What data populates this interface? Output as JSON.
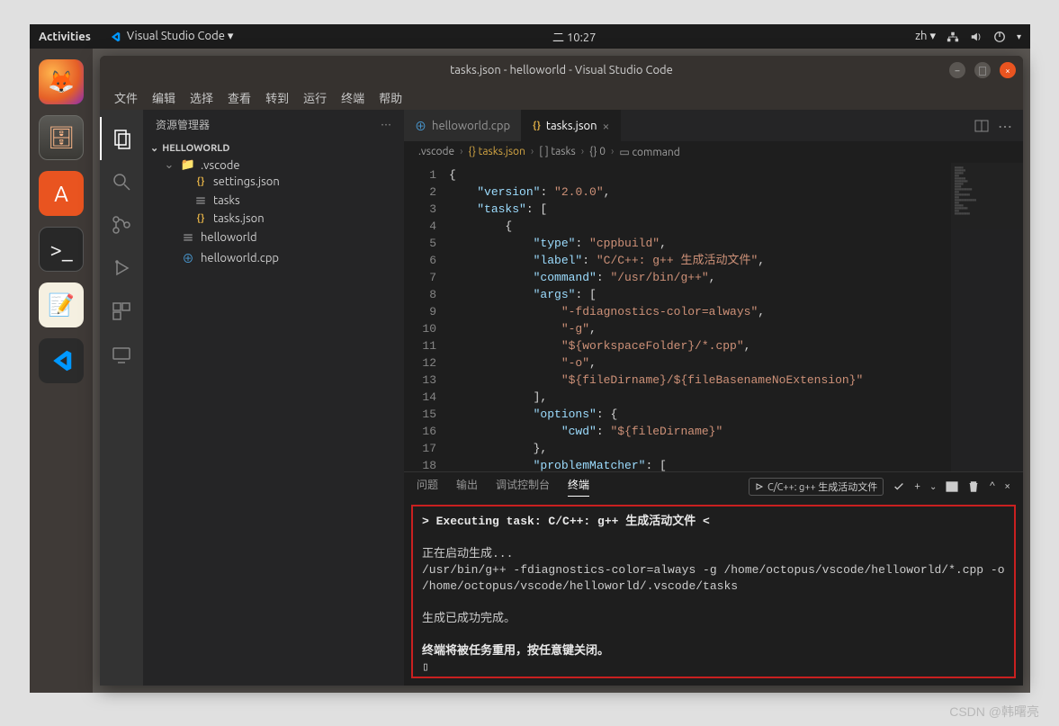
{
  "topPanel": {
    "activities": "Activities",
    "appName": "Visual Studio Code ▾",
    "clock": "二 10:27",
    "lang": "zh ▾"
  },
  "window": {
    "title": "tasks.json - helloworld - Visual Studio Code"
  },
  "menu": [
    "文件",
    "编辑",
    "选择",
    "查看",
    "转到",
    "运行",
    "终端",
    "帮助"
  ],
  "sidebar": {
    "title": "资源管理器",
    "root": "HELLOWORLD",
    "items": [
      {
        "name": ".vscode",
        "type": "folder",
        "open": true,
        "indent": 1
      },
      {
        "name": "settings.json",
        "type": "json",
        "indent": 2
      },
      {
        "name": "tasks",
        "type": "file",
        "indent": 2
      },
      {
        "name": "tasks.json",
        "type": "json",
        "indent": 2
      },
      {
        "name": "helloworld",
        "type": "file",
        "indent": 1
      },
      {
        "name": "helloworld.cpp",
        "type": "cpp",
        "indent": 1
      }
    ]
  },
  "tabs": [
    {
      "label": "helloworld.cpp",
      "icon": "cpp",
      "active": false
    },
    {
      "label": "tasks.json",
      "icon": "json",
      "active": true
    }
  ],
  "breadcrumb": [
    ".vscode",
    "{} tasks.json",
    "[ ] tasks",
    "{} 0",
    "▭ command"
  ],
  "code": {
    "lines": [
      [
        {
          "cls": "tok-brace",
          "t": "{"
        }
      ],
      [
        {
          "cls": "",
          "t": "    "
        },
        {
          "cls": "tok-key",
          "t": "\"version\""
        },
        {
          "cls": "tok-punct",
          "t": ": "
        },
        {
          "cls": "tok-str",
          "t": "\"2.0.0\""
        },
        {
          "cls": "tok-punct",
          "t": ","
        }
      ],
      [
        {
          "cls": "",
          "t": "    "
        },
        {
          "cls": "tok-key",
          "t": "\"tasks\""
        },
        {
          "cls": "tok-punct",
          "t": ": ["
        }
      ],
      [
        {
          "cls": "",
          "t": "        "
        },
        {
          "cls": "tok-brace",
          "t": "{"
        }
      ],
      [
        {
          "cls": "",
          "t": "            "
        },
        {
          "cls": "tok-key",
          "t": "\"type\""
        },
        {
          "cls": "tok-punct",
          "t": ": "
        },
        {
          "cls": "tok-str",
          "t": "\"cppbuild\""
        },
        {
          "cls": "tok-punct",
          "t": ","
        }
      ],
      [
        {
          "cls": "",
          "t": "            "
        },
        {
          "cls": "tok-key",
          "t": "\"label\""
        },
        {
          "cls": "tok-punct",
          "t": ": "
        },
        {
          "cls": "tok-str",
          "t": "\"C/C++: g++ 生成活动文件\""
        },
        {
          "cls": "tok-punct",
          "t": ","
        }
      ],
      [
        {
          "cls": "",
          "t": "            "
        },
        {
          "cls": "tok-key",
          "t": "\"command\""
        },
        {
          "cls": "tok-punct",
          "t": ": "
        },
        {
          "cls": "tok-str",
          "t": "\"/usr/bin/g++\""
        },
        {
          "cls": "tok-punct",
          "t": ","
        }
      ],
      [
        {
          "cls": "",
          "t": "            "
        },
        {
          "cls": "tok-key",
          "t": "\"args\""
        },
        {
          "cls": "tok-punct",
          "t": ": ["
        }
      ],
      [
        {
          "cls": "",
          "t": "                "
        },
        {
          "cls": "tok-str",
          "t": "\"-fdiagnostics-color=always\""
        },
        {
          "cls": "tok-punct",
          "t": ","
        }
      ],
      [
        {
          "cls": "",
          "t": "                "
        },
        {
          "cls": "tok-str",
          "t": "\"-g\""
        },
        {
          "cls": "tok-punct",
          "t": ","
        }
      ],
      [
        {
          "cls": "",
          "t": "                "
        },
        {
          "cls": "tok-str",
          "t": "\"${workspaceFolder}/*.cpp\""
        },
        {
          "cls": "tok-punct",
          "t": ","
        }
      ],
      [
        {
          "cls": "",
          "t": "                "
        },
        {
          "cls": "tok-str",
          "t": "\"-o\""
        },
        {
          "cls": "tok-punct",
          "t": ","
        }
      ],
      [
        {
          "cls": "",
          "t": "                "
        },
        {
          "cls": "tok-str",
          "t": "\"${fileDirname}/${fileBasenameNoExtension}\""
        }
      ],
      [
        {
          "cls": "",
          "t": "            "
        },
        {
          "cls": "tok-punct",
          "t": "],"
        }
      ],
      [
        {
          "cls": "",
          "t": "            "
        },
        {
          "cls": "tok-key",
          "t": "\"options\""
        },
        {
          "cls": "tok-punct",
          "t": ": {"
        }
      ],
      [
        {
          "cls": "",
          "t": "                "
        },
        {
          "cls": "tok-key",
          "t": "\"cwd\""
        },
        {
          "cls": "tok-punct",
          "t": ": "
        },
        {
          "cls": "tok-str",
          "t": "\"${fileDirname}\""
        }
      ],
      [
        {
          "cls": "",
          "t": "            "
        },
        {
          "cls": "tok-punct",
          "t": "},"
        }
      ],
      [
        {
          "cls": "",
          "t": "            "
        },
        {
          "cls": "tok-key",
          "t": "\"problemMatcher\""
        },
        {
          "cls": "tok-punct",
          "t": ": ["
        }
      ]
    ]
  },
  "panel": {
    "tabs": [
      "问题",
      "输出",
      "调试控制台",
      "终端"
    ],
    "activeTab": "终端",
    "taskLabel": "C/C++: g++ 生成活动文件"
  },
  "terminal": {
    "exec": "> Executing task: C/C++: g++ 生成活动文件 <",
    "line1": "正在启动生成...",
    "line2": "/usr/bin/g++ -fdiagnostics-color=always -g /home/octopus/vscode/helloworld/*.cpp -o /home/octopus/vscode/helloworld/.vscode/tasks",
    "line3": "生成已成功完成。",
    "line4": "终端将被任务重用，按任意键关闭。",
    "cursor": "▯"
  },
  "watermark": "CSDN @韩曙亮"
}
